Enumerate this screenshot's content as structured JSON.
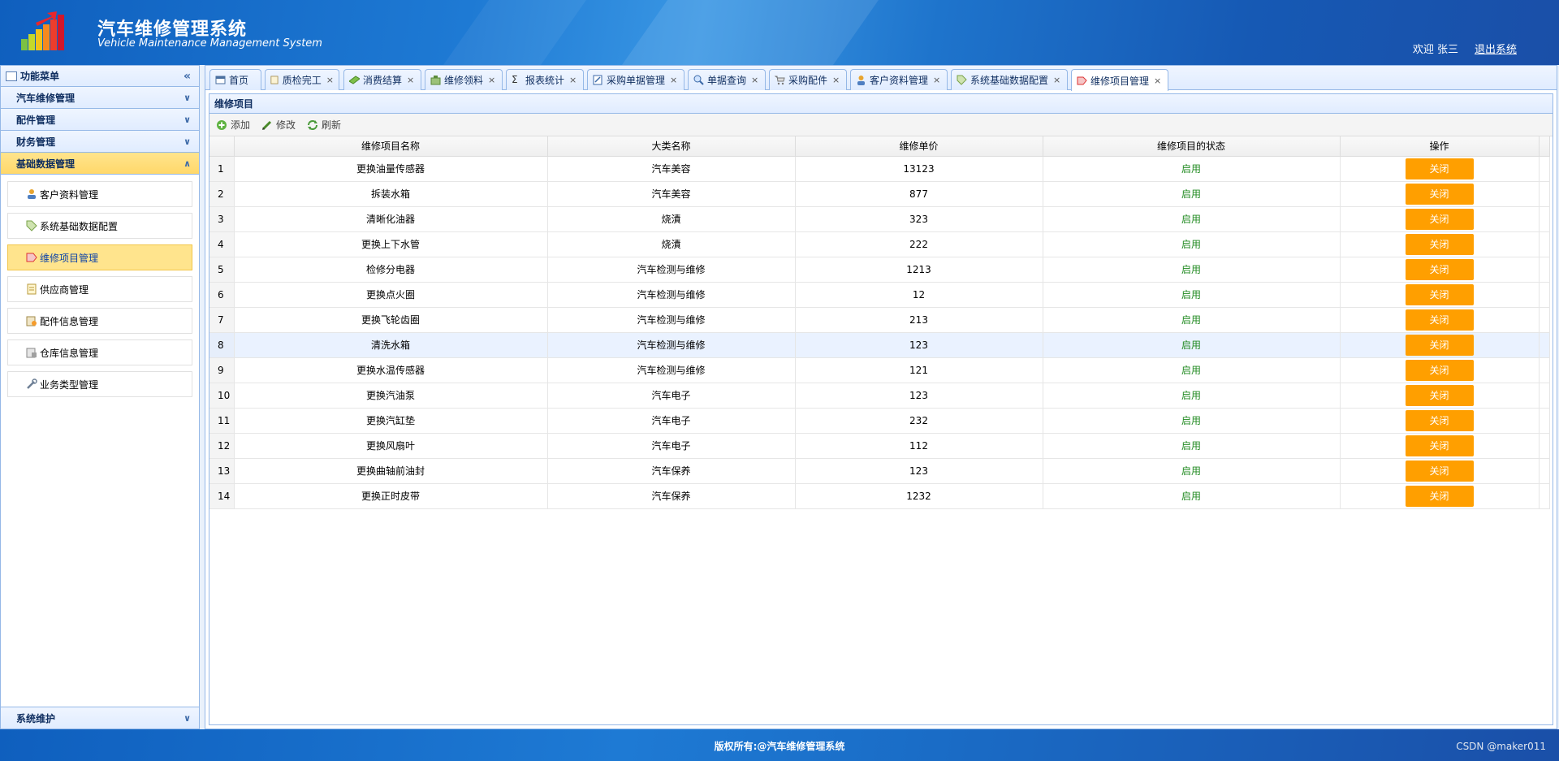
{
  "header": {
    "title": "汽车维修管理系统",
    "subtitle": "Vehicle Maintenance Management System",
    "welcome": "欢迎 张三",
    "logout": "退出系统"
  },
  "sidebar": {
    "header": "功能菜单",
    "collapse_icon": "«",
    "groups": [
      {
        "label": "汽车维修管理"
      },
      {
        "label": "配件管理"
      },
      {
        "label": "财务管理"
      },
      {
        "label": "基础数据管理"
      }
    ],
    "sub_items": [
      {
        "label": "客户资料管理",
        "icon": "user-icon"
      },
      {
        "label": "系统基础数据配置",
        "icon": "tag-icon"
      },
      {
        "label": "维修项目管理",
        "icon": "repair-icon"
      },
      {
        "label": "供应商管理",
        "icon": "doc-icon"
      },
      {
        "label": "配件信息管理",
        "icon": "parts-icon"
      },
      {
        "label": "仓库信息管理",
        "icon": "warehouse-icon"
      },
      {
        "label": "业务类型管理",
        "icon": "wrench-icon"
      }
    ],
    "bottom_group": "系统维护"
  },
  "tabs": [
    {
      "label": "首页",
      "closable": false
    },
    {
      "label": "质检完工",
      "closable": true
    },
    {
      "label": "消费结算",
      "closable": true
    },
    {
      "label": "维修领料",
      "closable": true
    },
    {
      "label": "报表统计",
      "closable": true
    },
    {
      "label": "采购单据管理",
      "closable": true
    },
    {
      "label": "单据查询",
      "closable": true
    },
    {
      "label": "采购配件",
      "closable": true
    },
    {
      "label": "客户资料管理",
      "closable": true
    },
    {
      "label": "系统基础数据配置",
      "closable": true
    },
    {
      "label": "维修项目管理",
      "closable": true
    }
  ],
  "tab_close_glyph": "×",
  "panel": {
    "title": "维修项目",
    "toolbar": {
      "add": "添加",
      "edit": "修改",
      "refresh": "刷新"
    },
    "columns": [
      "维修项目名称",
      "大类名称",
      "维修单价",
      "维修项目的状态",
      "操作"
    ],
    "rows": [
      {
        "no": "1",
        "name": "更换油量传感器",
        "category": "汽车美容",
        "price": "13123",
        "status": "启用",
        "action": "关闭"
      },
      {
        "no": "2",
        "name": "拆装水箱",
        "category": "汽车美容",
        "price": "877",
        "status": "启用",
        "action": "关闭"
      },
      {
        "no": "3",
        "name": "清晰化油器",
        "category": "烧漬",
        "price": "323",
        "status": "启用",
        "action": "关闭"
      },
      {
        "no": "4",
        "name": "更换上下水管",
        "category": "烧漬",
        "price": "222",
        "status": "启用",
        "action": "关闭"
      },
      {
        "no": "5",
        "name": "检修分电器",
        "category": "汽车检测与维修",
        "price": "1213",
        "status": "启用",
        "action": "关闭"
      },
      {
        "no": "6",
        "name": "更换点火圈",
        "category": "汽车检测与维修",
        "price": "12",
        "status": "启用",
        "action": "关闭"
      },
      {
        "no": "7",
        "name": "更换飞轮齿圈",
        "category": "汽车检测与维修",
        "price": "213",
        "status": "启用",
        "action": "关闭"
      },
      {
        "no": "8",
        "name": "清洗水箱",
        "category": "汽车检测与维修",
        "price": "123",
        "status": "启用",
        "action": "关闭"
      },
      {
        "no": "9",
        "name": "更换水温传感器",
        "category": "汽车检测与维修",
        "price": "121",
        "status": "启用",
        "action": "关闭"
      },
      {
        "no": "10",
        "name": "更换汽油泵",
        "category": "汽车电子",
        "price": "123",
        "status": "启用",
        "action": "关闭"
      },
      {
        "no": "11",
        "name": "更换汽缸垫",
        "category": "汽车电子",
        "price": "232",
        "status": "启用",
        "action": "关闭"
      },
      {
        "no": "12",
        "name": "更换风扇叶",
        "category": "汽车电子",
        "price": "112",
        "status": "启用",
        "action": "关闭"
      },
      {
        "no": "13",
        "name": "更换曲轴前油封",
        "category": "汽车保养",
        "price": "123",
        "status": "启用",
        "action": "关闭"
      },
      {
        "no": "14",
        "name": "更换正时皮带",
        "category": "汽车保养",
        "price": "1232",
        "status": "启用",
        "action": "关闭"
      }
    ]
  },
  "footer": {
    "copyright": "版权所有:@汽车维修管理系统",
    "watermark": "CSDN @maker011"
  },
  "colors": {
    "accent_blue": "#1e7ad4",
    "selected_yellow": "#ffe48d",
    "action_orange": "#ff9f00",
    "status_green": "#228b22"
  }
}
